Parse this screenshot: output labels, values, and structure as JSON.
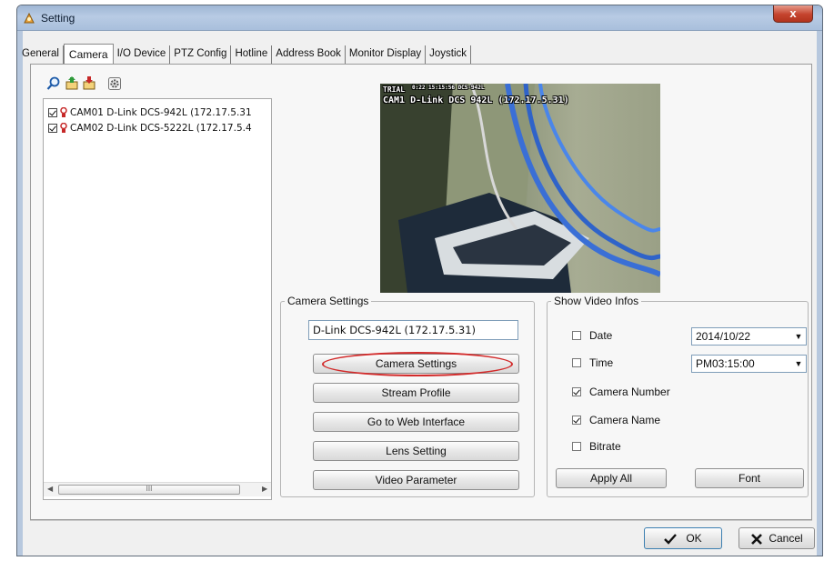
{
  "window": {
    "title": "Setting",
    "close_glyph": "x"
  },
  "tabs": [
    {
      "label": "General",
      "active": false
    },
    {
      "label": "Camera",
      "active": true
    },
    {
      "label": "I/O Device",
      "active": false
    },
    {
      "label": "PTZ Config",
      "active": false
    },
    {
      "label": "Hotline",
      "active": false
    },
    {
      "label": "Address Book",
      "active": false
    },
    {
      "label": "Monitor Display",
      "active": false
    },
    {
      "label": "Joystick",
      "active": false
    }
  ],
  "toolbar": {
    "icons": [
      "search-icon",
      "add-camera-icon",
      "remove-camera-icon",
      "settings-gear-icon"
    ]
  },
  "camera_list": {
    "items": [
      {
        "label": "CAM01 D-Link DCS-942L (172.17.5.31",
        "checked": true
      },
      {
        "label": "CAM02 D-Link DCS-5222L (172.17.5.4",
        "checked": true
      }
    ],
    "scrollbar_grip": "III"
  },
  "preview": {
    "osd_trial": "TRIAL",
    "osd_timestamp": "0:22 15:15:56 DCS-942L",
    "osd_camera": "CAM1 D-Link DCS 942L (172.17.5.31)"
  },
  "camera_settings": {
    "group_label": "Camera Settings",
    "camera_name_value": "D-Link DCS-942L (172.17.5.31)",
    "buttons": {
      "camera_settings": "Camera Settings",
      "stream_profile": "Stream Profile",
      "web_interface": "Go to Web Interface",
      "lens_setting": "Lens Setting",
      "video_parameter": "Video Parameter"
    }
  },
  "show_video_infos": {
    "group_label": "Show Video Infos",
    "options": {
      "date": {
        "label": "Date",
        "checked": false,
        "value": "2014/10/22"
      },
      "time": {
        "label": "Time",
        "checked": false,
        "value": "PM03:15:00"
      },
      "camera_number": {
        "label": "Camera Number",
        "checked": true
      },
      "camera_name": {
        "label": "Camera Name",
        "checked": true
      },
      "bitrate": {
        "label": "Bitrate",
        "checked": false
      }
    },
    "apply_all": "Apply All",
    "font": "Font"
  },
  "footer": {
    "ok": "OK",
    "cancel": "Cancel"
  },
  "colors": {
    "highlight": "#d22a2a",
    "title_bar": "#b8cbe4",
    "close_button": "#c4432d"
  }
}
